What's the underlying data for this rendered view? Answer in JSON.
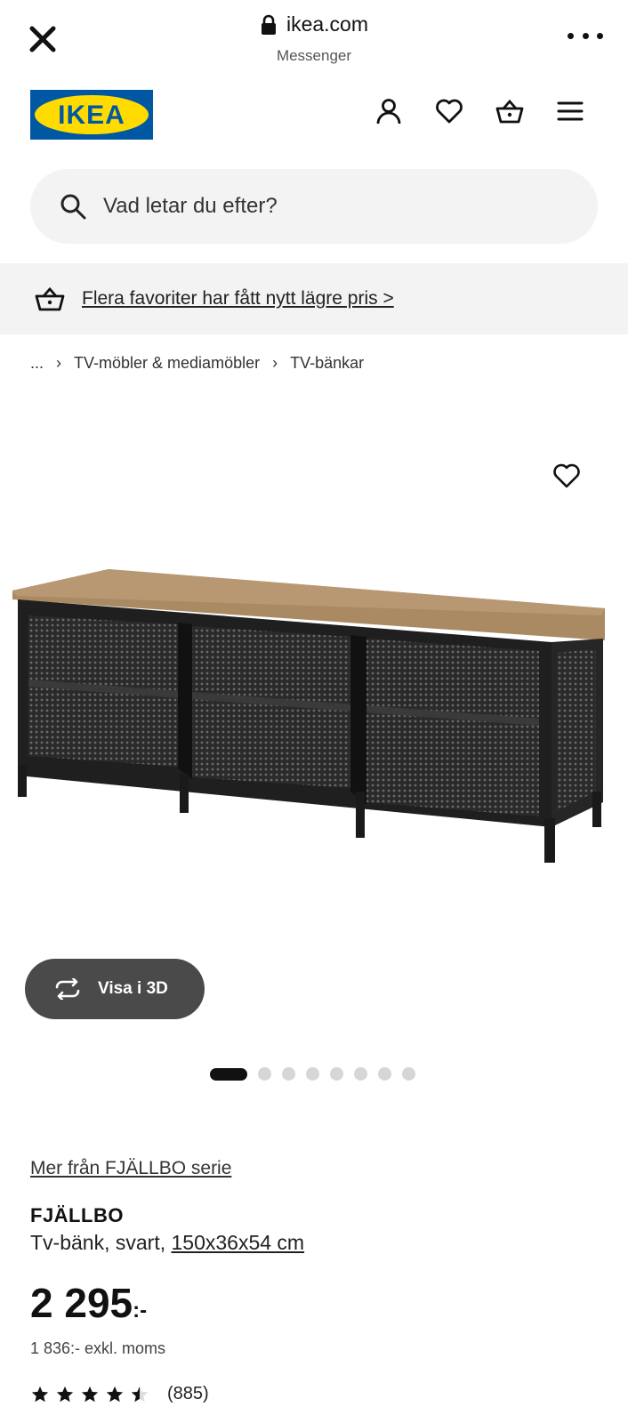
{
  "browser": {
    "domain": "ikea.com",
    "subtitle": "Messenger"
  },
  "header": {
    "logo_text": "IKEA",
    "icons": [
      "user-icon",
      "heart-icon",
      "cart-icon",
      "menu-icon"
    ],
    "brand_blue": "#0058a3",
    "brand_yellow": "#ffdb00"
  },
  "search": {
    "placeholder": "Vad letar du efter?"
  },
  "promo": {
    "text": "Flera favoriter har fått nytt lägre pris >"
  },
  "breadcrumb": {
    "items": [
      "...",
      "TV-möbler & mediamöbler",
      "TV-bänkar"
    ]
  },
  "gallery": {
    "view3d_label": "Visa i 3D",
    "image_count": 8,
    "active_index": 0
  },
  "product": {
    "series_link": "Mer från FJÄLLBO serie",
    "name": "FJÄLLBO",
    "desc_prefix": "Tv-bänk, svart, ",
    "dimensions": "150x36x54 cm",
    "price": "2 295",
    "price_suffix": ":-",
    "price_ex_vat": "1 836:- exkl. moms",
    "rating": 4.5,
    "review_count": "(885)"
  }
}
